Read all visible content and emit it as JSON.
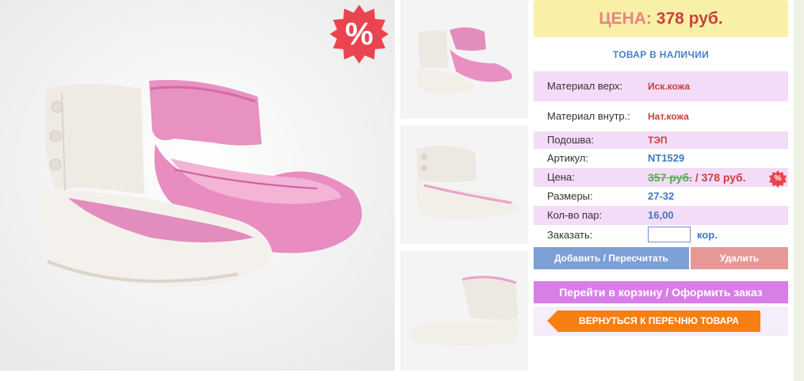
{
  "product": {
    "discount_badge": "%",
    "thumbnails": [
      "thumbnail-1",
      "thumbnail-2",
      "thumbnail-3"
    ]
  },
  "price": {
    "label": "ЦЕНА:",
    "value": "378 руб."
  },
  "stock_status": "ТОВАР В НАЛИЧИИ",
  "details": {
    "material_top_label": "Материал верх:",
    "material_top_value": "Иск.кожа",
    "material_inner_label": "Материал внутр.:",
    "material_inner_value": "Нат.кожа",
    "sole_label": "Подошва:",
    "sole_value": "ТЭП",
    "article_label": "Артикул:",
    "article_value": "NT1529",
    "price_label": "Цена:",
    "price_old": "357 руб.",
    "price_sep": " / ",
    "price_new": "378 руб.",
    "price_badge": "%",
    "sizes_label": "Размеры:",
    "sizes_value": "27-32",
    "pairs_label": "Кол-во пар:",
    "pairs_value": "16,00",
    "order_label": "Заказать:",
    "order_input_value": "",
    "order_unit": "кор."
  },
  "buttons": {
    "add": "Добавить / Пересчитать",
    "delete": "Удалить",
    "cart": "Перейти в корзину / Оформить заказ",
    "back": "ВЕРНУТЬСЯ К ПЕРЕЧНЮ ТОВАРА"
  },
  "colors": {
    "price_bg": "#f9f0a8",
    "accent_red": "#c9403c",
    "accent_blue": "#3f79c2",
    "row_pink": "#f3dcf7",
    "add_button": "#7c9fd6",
    "delete_button": "#e89797",
    "cart_button": "#d87ee7",
    "back_button": "#f77f12"
  },
  "icons": [
    "discount-badge-icon",
    "back-arrow-icon"
  ]
}
